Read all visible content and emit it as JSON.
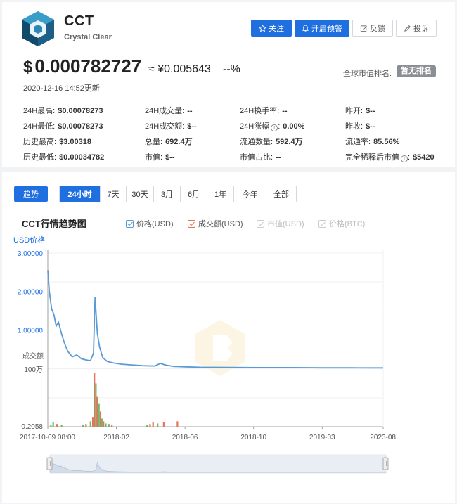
{
  "coin": {
    "symbol": "CCT",
    "name": "Crystal Clear"
  },
  "header_buttons": {
    "follow": "关注",
    "alert": "开启预警",
    "feedback": "反馈",
    "report": "投诉"
  },
  "price": {
    "currency_symbol": "$",
    "usd": "0.000782727",
    "approx": "≈",
    "cny": "¥0.005643",
    "change": "--%",
    "updated": "2020-12-16 14:52更新"
  },
  "rank": {
    "label": "全球市值排名:",
    "value": "暂无排名"
  },
  "stats": {
    "high24_label": "24H最高:",
    "high24": "$0.00078273",
    "vol24_label": "24H成交量:",
    "vol24": "--",
    "turnover24_label": "24H换手率:",
    "turnover24": "--",
    "open_label": "昨开:",
    "open": "$--",
    "low24_label": "24H最低:",
    "low24": "$0.00078273",
    "amount24_label": "24H成交额:",
    "amount24": "$--",
    "amp24_label": "24H涨幅",
    "amp24": "0.00%",
    "close_label": "昨收:",
    "close": "$--",
    "ath_label": "历史最高:",
    "ath": "$3.00318",
    "supply_label": "总量:",
    "supply": "692.4万",
    "circ_label": "流通数量:",
    "circ": "592.4万",
    "circrate_label": "流通率:",
    "circrate": "85.56%",
    "atl_label": "历史最低:",
    "atl": "$0.00034782",
    "mcap_label": "市值:",
    "mcap": "$--",
    "share_label": "市值占比:",
    "share": "--",
    "fdv_label": "完全稀释后市值",
    "fdv": "$5420"
  },
  "tabs": {
    "trend": "趋势"
  },
  "ranges": [
    "24小时",
    "7天",
    "30天",
    "3月",
    "6月",
    "1年",
    "今年",
    "全部"
  ],
  "chart": {
    "title": "CCT行情趋势图"
  },
  "legend": [
    {
      "label": "价格(USD)",
      "color": "#5b9bd5",
      "active": true
    },
    {
      "label": "成交额(USD)",
      "color": "#e8735a",
      "active": true
    },
    {
      "label": "市值(USD)",
      "color": "#cccccc",
      "active": false
    },
    {
      "label": "价格(BTC)",
      "color": "#cccccc",
      "active": false
    }
  ],
  "colors": {
    "accent": "#1f6fe0",
    "price_line": "#5b9bd5",
    "bar_red": "#e8735a",
    "bar_green": "#6fb96f"
  },
  "chart_data": {
    "type": "line",
    "ylabel": "USD价格",
    "volume_label": "成交额",
    "y_ticks": [
      "3.00000",
      "2.00000",
      "1.00000"
    ],
    "ylim": [
      0,
      3
    ],
    "volume_ticks": [
      "100万",
      "0.2058"
    ],
    "x_ticks": [
      "2017-10-09 08:00",
      "2018-02",
      "2018-06",
      "2018-10",
      "2019-03",
      "2023-08"
    ],
    "xlim": [
      0,
      22
    ],
    "series": [
      {
        "name": "价格(USD)",
        "x": [
          0,
          0.1,
          0.25,
          0.4,
          0.55,
          0.7,
          0.9,
          1.1,
          1.3,
          1.6,
          1.9,
          2.2,
          2.5,
          2.8,
          3.0,
          3.1,
          3.25,
          3.4,
          3.6,
          3.9,
          4.3,
          4.8,
          5.5,
          6.2,
          7.0,
          7.4,
          7.6,
          7.8,
          8.3,
          9,
          10,
          12,
          14,
          16,
          18,
          20,
          22
        ],
        "values": [
          2.55,
          2.0,
          1.55,
          1.4,
          1.1,
          1.2,
          0.9,
          0.65,
          0.45,
          0.3,
          0.35,
          0.25,
          0.22,
          0.2,
          0.4,
          1.85,
          0.9,
          0.55,
          0.28,
          0.18,
          0.14,
          0.11,
          0.09,
          0.07,
          0.06,
          0.13,
          0.1,
          0.08,
          0.05,
          0.04,
          0.03,
          0.025,
          0.02,
          0.02,
          0.015,
          0.015,
          0.012
        ]
      }
    ],
    "volume_bars": [
      {
        "x": 0.2,
        "v": 0.04,
        "c": "g"
      },
      {
        "x": 0.35,
        "v": 0.08,
        "c": "g"
      },
      {
        "x": 0.6,
        "v": 0.05,
        "c": "r"
      },
      {
        "x": 0.9,
        "v": 0.03,
        "c": "g"
      },
      {
        "x": 2.3,
        "v": 0.04,
        "c": "g"
      },
      {
        "x": 2.5,
        "v": 0.05,
        "c": "r"
      },
      {
        "x": 2.8,
        "v": 0.1,
        "c": "g"
      },
      {
        "x": 2.95,
        "v": 0.18,
        "c": "r"
      },
      {
        "x": 3.05,
        "v": 1.0,
        "c": "r"
      },
      {
        "x": 3.15,
        "v": 0.8,
        "c": "g"
      },
      {
        "x": 3.25,
        "v": 0.55,
        "c": "r"
      },
      {
        "x": 3.35,
        "v": 0.42,
        "c": "g"
      },
      {
        "x": 3.45,
        "v": 0.28,
        "c": "r"
      },
      {
        "x": 3.55,
        "v": 0.15,
        "c": "g"
      },
      {
        "x": 3.65,
        "v": 0.1,
        "c": "r"
      },
      {
        "x": 3.8,
        "v": 0.06,
        "c": "g"
      },
      {
        "x": 4.0,
        "v": 0.05,
        "c": "g"
      },
      {
        "x": 4.2,
        "v": 0.03,
        "c": "r"
      },
      {
        "x": 6.5,
        "v": 0.03,
        "c": "g"
      },
      {
        "x": 6.7,
        "v": 0.05,
        "c": "r"
      },
      {
        "x": 6.9,
        "v": 0.09,
        "c": "r"
      },
      {
        "x": 7.2,
        "v": 0.06,
        "c": "g"
      },
      {
        "x": 7.6,
        "v": 0.09,
        "c": "r"
      },
      {
        "x": 8.5,
        "v": 0.1,
        "c": "r"
      }
    ]
  }
}
